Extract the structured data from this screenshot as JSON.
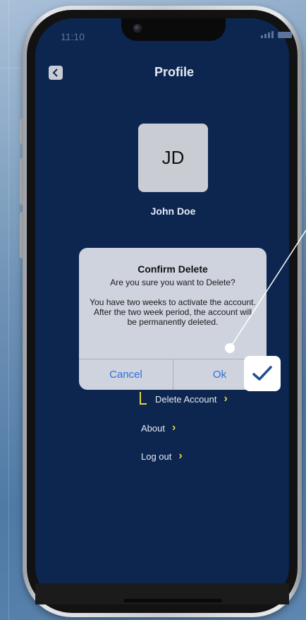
{
  "status_bar": {
    "time": "11:10"
  },
  "header": {
    "title": "Profile"
  },
  "profile": {
    "initials": "JD",
    "name": "John Doe"
  },
  "menu": {
    "delete_account": "Delete Account",
    "about": "About",
    "log_out": "Log out"
  },
  "alert": {
    "title": "Confirm Delete",
    "question": "Are you sure you want to Delete?",
    "detail": "You have  two weeks to activate the account. After the two week period, the account will be permanently deleted.",
    "cancel_label": "Cancel",
    "ok_label": "Ok"
  },
  "colors": {
    "screen_bg": "#0c2650",
    "accent_chevron": "#e7d43a",
    "alert_button": "#2f6fd9",
    "checkmark": "#1f4f8c"
  },
  "icons": {
    "back": "chevron-left-icon",
    "menu_chevron": "chevron-right-icon",
    "annotation": "checkmark-icon"
  }
}
